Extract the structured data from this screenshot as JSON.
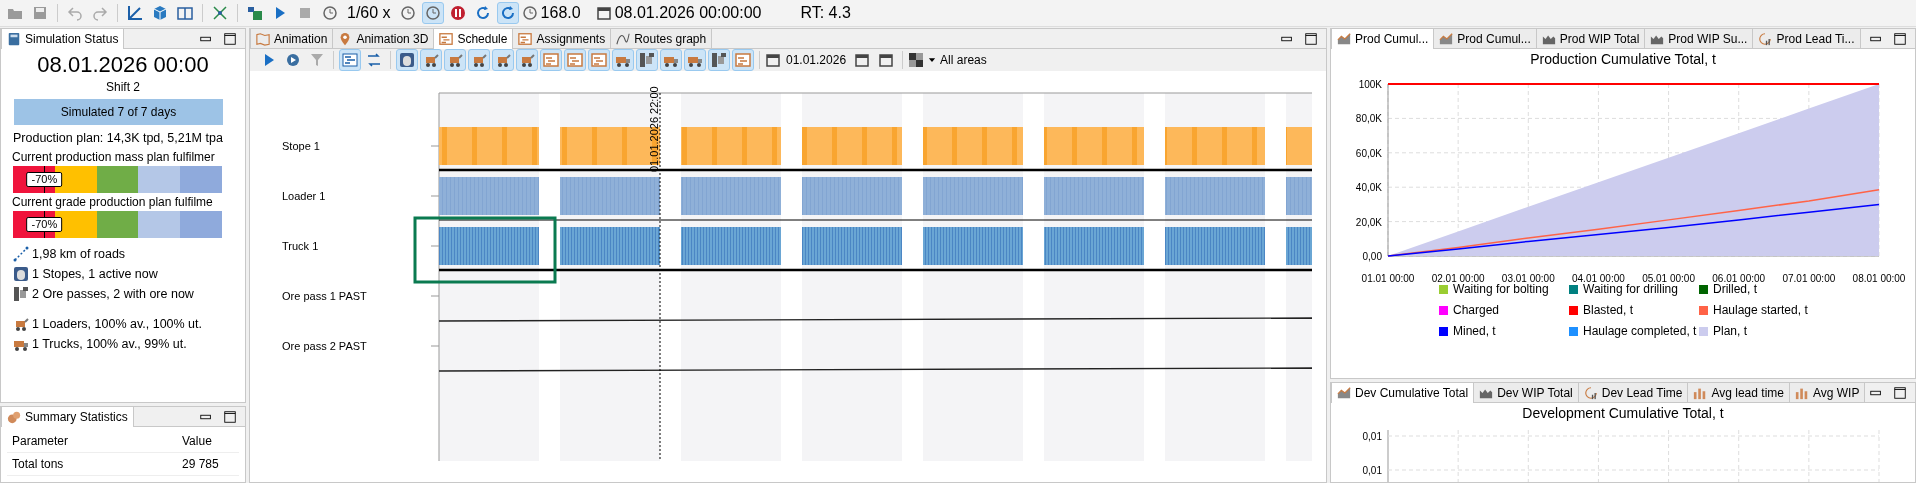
{
  "toolbar": {
    "speed": "1/60 x",
    "speed_buttons": [
      {
        "pressed": false
      },
      {
        "pressed": true
      },
      {
        "pressed": false
      },
      {
        "pressed": false
      },
      {
        "pressed": true
      }
    ],
    "model_time": "168.0",
    "date": "08.01.2026 00:00:00",
    "rt": "RT: 4.3"
  },
  "simulation_status": {
    "tab": "Simulation Status",
    "datetime": "08.01.2026 00:00",
    "shift": "Shift 2",
    "progress_text": "Simulated 7 of 7 days",
    "plan": "Production plan: 14,3K tpd, 5,21M tpa",
    "gauges": [
      {
        "label": "Current production mass plan fulfilmer",
        "marker": "-70%"
      },
      {
        "label": "Current grade production plan fulfilme",
        "marker": "-70%"
      }
    ],
    "facts": [
      {
        "kind": "roads",
        "text": "1,98 km of roads"
      },
      {
        "kind": "stopes",
        "text": "1 Stopes, 1 active now"
      },
      {
        "kind": "orepasses",
        "text": "2 Ore passes, 2 with ore now"
      },
      {
        "kind": "loaders",
        "text": "1 Loaders, 100% av., 100% ut."
      },
      {
        "kind": "trucks",
        "text": "1 Trucks, 100% av., 99% ut."
      }
    ]
  },
  "summary_statistics": {
    "tab": "Summary Statistics",
    "columns": [
      "Parameter",
      "Value"
    ],
    "rows": [
      [
        "Total tons",
        "29 785"
      ]
    ]
  },
  "center_tabs": [
    {
      "label": "Animation",
      "selected": false
    },
    {
      "label": "Animation 3D",
      "selected": false
    },
    {
      "label": "Schedule",
      "selected": true
    },
    {
      "label": "Assignments",
      "selected": false
    },
    {
      "label": "Routes graph",
      "selected": false
    }
  ],
  "schedule_toolbar": {
    "filters": [
      {
        "pressed": true
      },
      {
        "pressed": true
      },
      {
        "pressed": true
      },
      {
        "pressed": true
      },
      {
        "pressed": true
      },
      {
        "pressed": true
      },
      {
        "pressed": true
      },
      {
        "pressed": true
      },
      {
        "pressed": true
      },
      {
        "pressed": true
      },
      {
        "pressed": true
      },
      {
        "pressed": true
      },
      {
        "pressed": true
      },
      {
        "pressed": true
      },
      {
        "pressed": true
      }
    ],
    "date": "01.01.2026",
    "area": "All areas"
  },
  "schedule": {
    "marker": "01.01.2026 22:00",
    "rows": [
      {
        "label": "Stope 1",
        "kind": "stope",
        "selected": false
      },
      {
        "label": "Loader 1",
        "kind": "loader",
        "selected": false
      },
      {
        "label": "Truck 1",
        "kind": "truck",
        "selected": true
      },
      {
        "label": "Ore pass 1 PAST",
        "kind": "orepass",
        "selected": false
      },
      {
        "label": "Ore pass 2 PAST",
        "kind": "orepass",
        "selected": false
      }
    ]
  },
  "prod_tabs": [
    {
      "label": "Prod Cumul...",
      "selected": true
    },
    {
      "label": "Prod Cumul...",
      "selected": false
    },
    {
      "label": "Prod WIP Total",
      "selected": false
    },
    {
      "label": "Prod WIP Su...",
      "selected": false
    },
    {
      "label": "Prod Lead Ti...",
      "selected": false
    }
  ],
  "prod_chart": {
    "chart_data": {
      "type": "line",
      "title": "Production Cumulative Total, t",
      "categories": [
        "01.01 00:00",
        "02.01 00:00",
        "03.01 00:00",
        "04.01 00:00",
        "05.01 00:00",
        "06.01 00:00",
        "07.01 00:00",
        "08.01 00:00"
      ],
      "ylim": [
        0,
        100000
      ],
      "grid": true,
      "yticks": [
        {
          "value": 0,
          "label": "0,00"
        },
        {
          "value": 20000,
          "label": "20,0K"
        },
        {
          "value": 40000,
          "label": "40,0K"
        },
        {
          "value": 60000,
          "label": "60,0K"
        },
        {
          "value": 80000,
          "label": "80,0K"
        },
        {
          "value": 100000,
          "label": "100K"
        }
      ],
      "series": [
        {
          "name": "Waiting for bolting",
          "color": "#9acd32",
          "type": "line",
          "values": [
            null,
            null,
            null,
            null,
            null,
            null,
            null,
            null
          ]
        },
        {
          "name": "Waiting for drilling",
          "color": "#008080",
          "type": "line",
          "values": [
            null,
            null,
            null,
            null,
            null,
            null,
            null,
            null
          ]
        },
        {
          "name": "Drilled, t",
          "color": "#006400",
          "type": "line",
          "values": [
            null,
            null,
            null,
            null,
            null,
            null,
            null,
            null
          ]
        },
        {
          "name": "Charged",
          "color": "#ff00ff",
          "type": "line",
          "values": [
            null,
            null,
            null,
            null,
            null,
            null,
            null,
            null
          ]
        },
        {
          "name": "Blasted, t",
          "color": "#ff0000",
          "type": "line",
          "values": [
            100000,
            100000,
            100000,
            100000,
            100000,
            100000,
            100000,
            100000
          ]
        },
        {
          "name": "Haulage started, t",
          "color": "#ff6347",
          "type": "line",
          "values": [
            0,
            5000,
            10500,
            15500,
            21000,
            26500,
            32000,
            38500
          ]
        },
        {
          "name": "Mined, t",
          "color": "#0000ff",
          "type": "line",
          "values": [
            0,
            4000,
            8500,
            12500,
            16500,
            21000,
            25500,
            30000
          ]
        },
        {
          "name": "Haulage completed, t",
          "color": "#1e90ff",
          "type": "line",
          "values": [
            null,
            null,
            null,
            null,
            null,
            null,
            null,
            null
          ]
        },
        {
          "name": "Plan, t",
          "color": "#ccccee",
          "type": "area",
          "values": [
            0,
            14300,
            28600,
            42900,
            57100,
            71400,
            85700,
            100000
          ]
        }
      ]
    }
  },
  "dev_tabs": [
    {
      "label": "Dev Cumulative Total",
      "kind": "line",
      "selected": true
    },
    {
      "label": "Dev WIP Total",
      "kind": "wip",
      "selected": false
    },
    {
      "label": "Dev Lead Time",
      "kind": "gauge",
      "selected": false
    },
    {
      "label": "Avg lead time",
      "kind": "bars",
      "selected": false
    },
    {
      "label": "Avg WIP",
      "kind": "bars",
      "selected": false
    }
  ],
  "dev_chart": {
    "title": "Development Cumulative Total, t",
    "ytick_labels": [
      "0,01",
      "0,01"
    ]
  }
}
